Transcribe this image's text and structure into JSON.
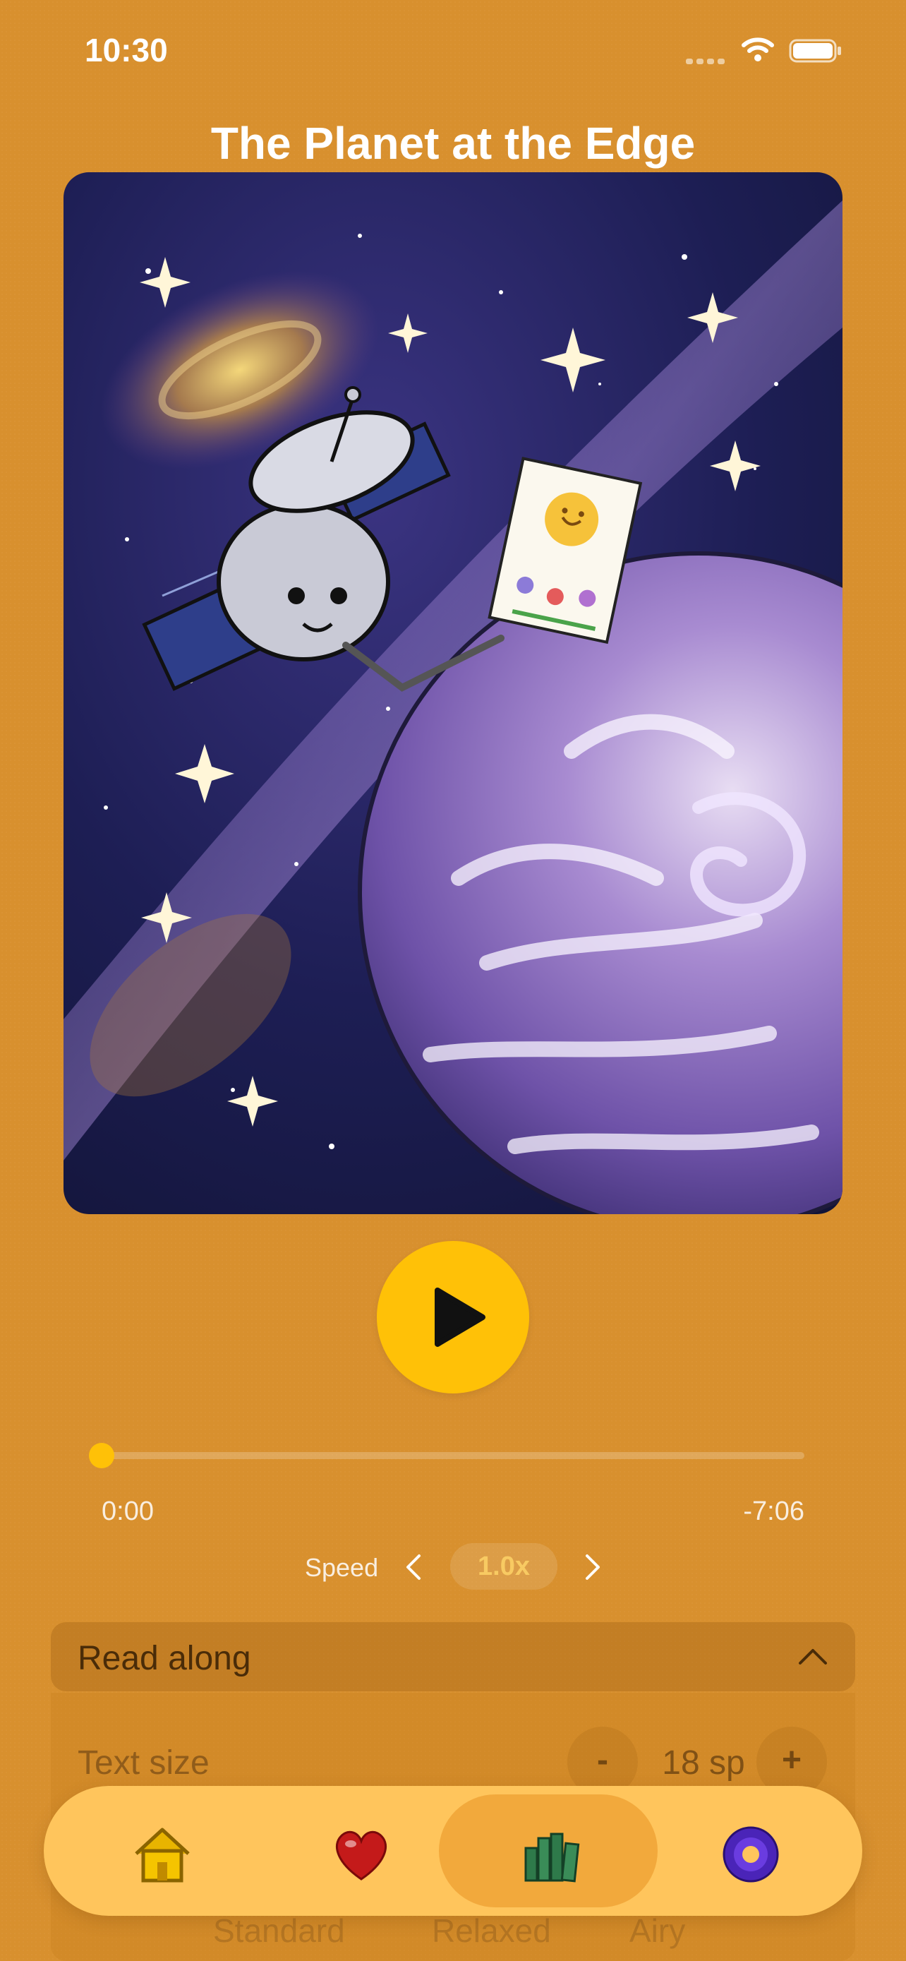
{
  "status_bar": {
    "time": "10:30"
  },
  "story": {
    "title": "The Planet at the Edge"
  },
  "player": {
    "elapsed": "0:00",
    "remaining": "-7:06",
    "progress_fraction": 0.0
  },
  "speed": {
    "label": "Speed",
    "value": "1.0x"
  },
  "read_along": {
    "title": "Read along",
    "text_size_label": "Text size",
    "minus_label": "-",
    "text_size_value": "18 sp",
    "plus_label": "+",
    "font_options": [
      "Standard",
      "Relaxed",
      "Airy"
    ]
  },
  "tab_bar": {
    "tabs": [
      {
        "icon": "home-icon",
        "active": false
      },
      {
        "icon": "heart-icon",
        "active": false
      },
      {
        "icon": "books-icon",
        "active": true
      },
      {
        "icon": "settings-icon",
        "active": false
      }
    ]
  },
  "colors": {
    "background": "#D8902E",
    "accent": "#FFC107",
    "tab_bar": "#FFC55C",
    "tab_active": "#F2A93C"
  }
}
